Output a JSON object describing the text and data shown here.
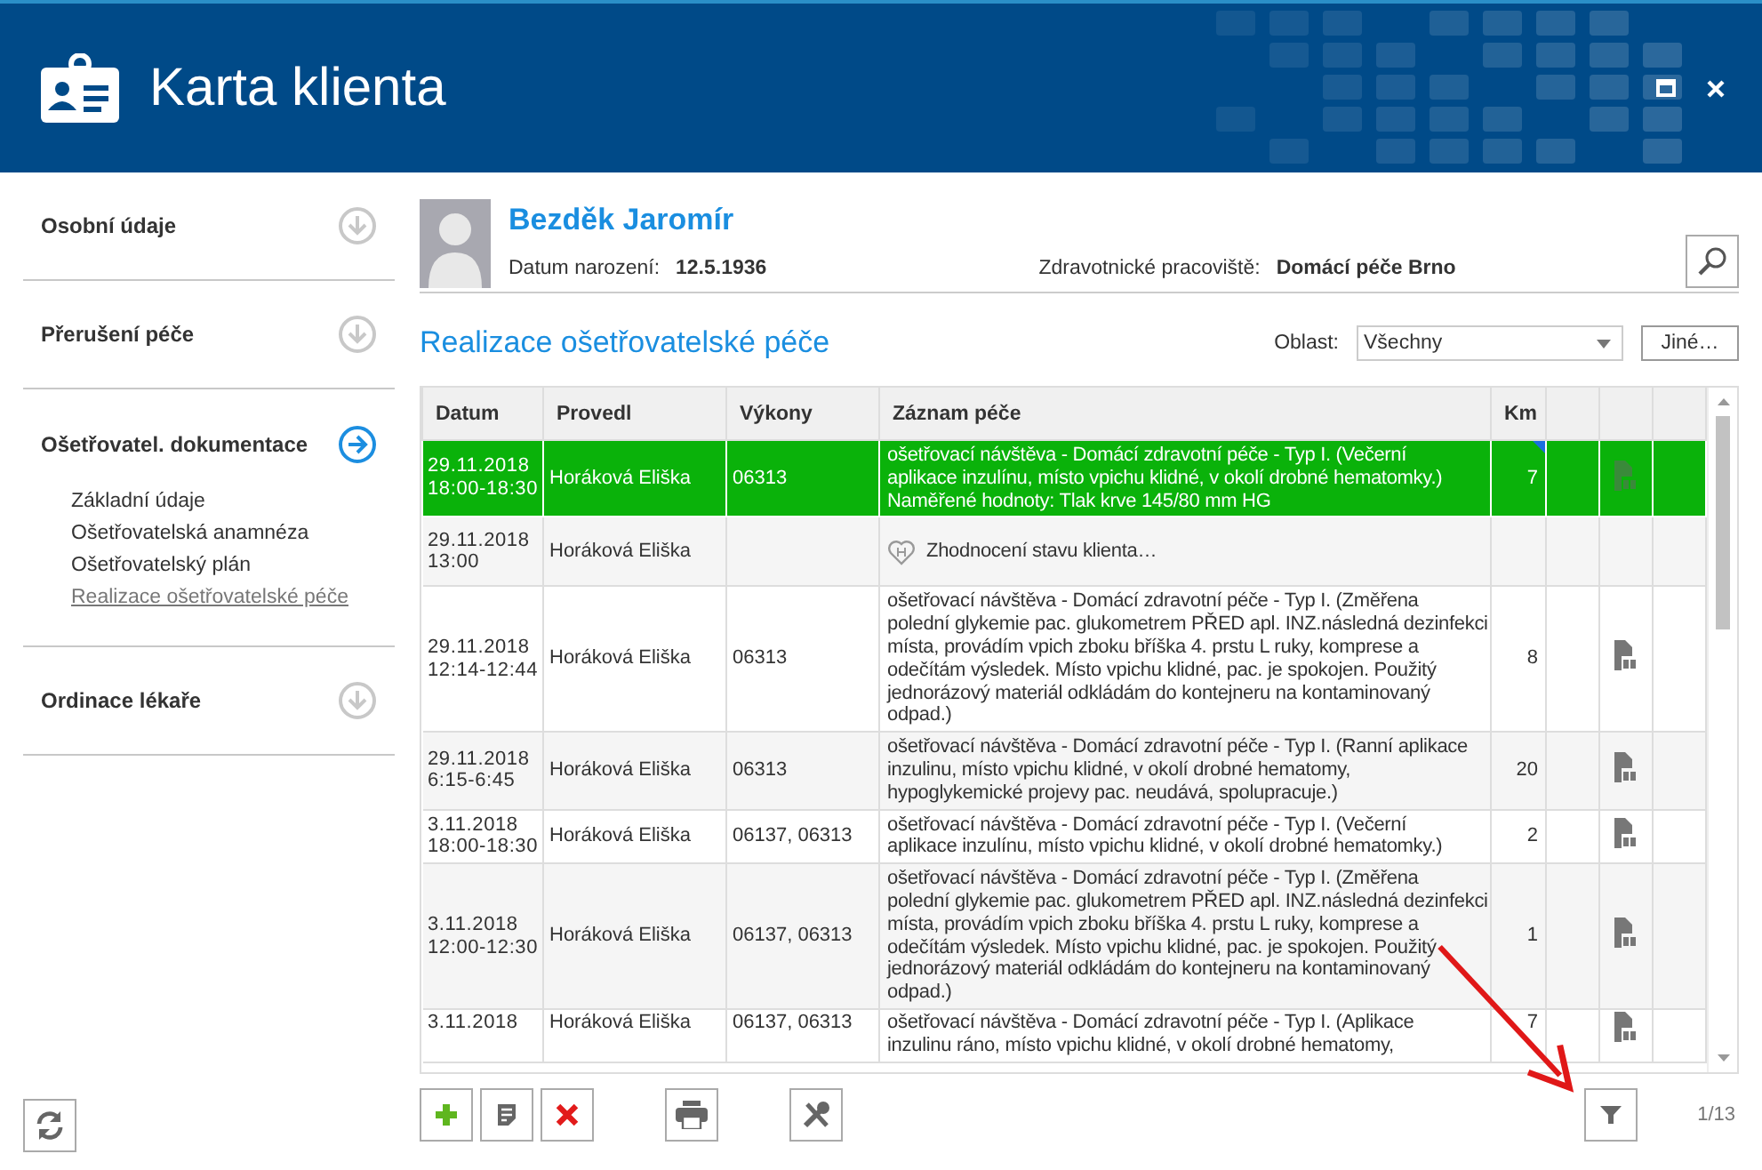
{
  "window": {
    "title": "Karta klienta"
  },
  "sidebar": {
    "sections": [
      {
        "label": "Osobní údaje",
        "selected": false
      },
      {
        "label": "Přerušení péče",
        "selected": false
      },
      {
        "label": "Ošetřovatel. dokumentace",
        "selected": true,
        "items": [
          {
            "label": "Základní údaje",
            "selected": false
          },
          {
            "label": "Ošetřovatelská anamnéza",
            "selected": false
          },
          {
            "label": "Ošetřovatelský plán",
            "selected": false
          },
          {
            "label": "Realizace ošetřovatelské péče",
            "selected": true
          }
        ]
      },
      {
        "label": "Ordinace lékaře",
        "selected": false
      }
    ]
  },
  "patient": {
    "name": "Bezděk Jaromír",
    "birth_label": "Datum narození:",
    "birth_date": "12.5.1936",
    "workplace_label": "Zdravotnické pracoviště:",
    "workplace": "Domácí péče Brno"
  },
  "section_title": "Realizace ošetřovatelské péče",
  "filter": {
    "label": "Oblast:",
    "value": "Všechny",
    "button": "Jiné…"
  },
  "table": {
    "columns": [
      "Datum",
      "Provedl",
      "Výkony",
      "Záznam péče",
      "Km"
    ],
    "rows": [
      {
        "kind": "visit",
        "selected": true,
        "datum": [
          "29.11.2018",
          "18:00-18:30"
        ],
        "provedl": "Horáková Eliška",
        "vykony": "06313",
        "zaznam": [
          "ošetřovací návštěva - Domácí zdravotní péče - Typ I. (Večerní",
          "aplikace inzulínu, místo vpichu klidné, v okolí drobné hematomky.)",
          "Naměřené hodnoty: Tlak krve 145/80 mm HG"
        ],
        "km": "7",
        "flagged": true
      },
      {
        "kind": "evaluation",
        "selected": false,
        "datum": [
          "29.11.2018",
          "13:00"
        ],
        "provedl": "Horáková Eliška",
        "vykony": "",
        "zaznam": [
          "Zhodnocení stavu klienta…"
        ],
        "km": ""
      },
      {
        "kind": "visit",
        "selected": false,
        "datum": [
          "29.11.2018",
          "12:14-12:44"
        ],
        "provedl": "Horáková Eliška",
        "vykony": "06313",
        "zaznam": [
          "ošetřovací návštěva - Domácí zdravotní péče - Typ I. (Změřena",
          "polední glykemie pac. glukometrem PŘED apl. INZ.následná dezinfekci",
          "místa, provádím vpich zboku bříška 4. prstu L ruky, komprese a",
          "odečítám výsledek. Místo vpichu klidné, pac. je spokojen. Použitý",
          "jednorázový materiál odkládám do kontejneru na kontaminovaný",
          "odpad.)"
        ],
        "km": "8"
      },
      {
        "kind": "visit",
        "selected": false,
        "datum": [
          "29.11.2018",
          "6:15-6:45"
        ],
        "provedl": "Horáková Eliška",
        "vykony": "06313",
        "zaznam": [
          "ošetřovací návštěva - Domácí zdravotní péče - Typ I. (Ranní aplikace",
          "inzulinu,  místo vpichu klidné, v okolí drobné hematomy,",
          "hypoglykemické projevy pac. neudává, spolupracuje.)"
        ],
        "km": "20"
      },
      {
        "kind": "visit",
        "selected": false,
        "datum": [
          "3.11.2018",
          "18:00-18:30"
        ],
        "provedl": "Horáková Eliška",
        "vykony": "06137, 06313",
        "zaznam": [
          "ošetřovací návštěva - Domácí zdravotní péče - Typ I. (Večerní",
          "aplikace inzulínu, místo vpichu klidné, v okolí drobné hematomky.)"
        ],
        "km": "2"
      },
      {
        "kind": "visit",
        "selected": false,
        "datum": [
          "3.11.2018",
          "12:00-12:30"
        ],
        "provedl": "Horáková Eliška",
        "vykony": "06137, 06313",
        "zaznam": [
          "ošetřovací návštěva - Domácí zdravotní péče - Typ I. (Změřena",
          "polední glykemie pac. glukometrem PŘED apl. INZ.následná dezinfekci",
          "místa, provádím vpich zboku bříška 4. prstu L ruky, komprese a",
          "odečítám výsledek. Místo vpichu klidné, pac. je spokojen. Použitý",
          "jednorázový materiál odkládám do kontejneru na kontaminovaný",
          "odpad.)"
        ],
        "km": "1"
      },
      {
        "kind": "visit",
        "selected": false,
        "datum": [
          "3.11.2018"
        ],
        "provedl": "Horáková Eliška",
        "vykony": "06137, 06313",
        "zaznam": [
          "ošetřovací návštěva - Domácí zdravotní péče - Typ I. (Aplikace",
          "inzulinu ráno,  místo vpichu klidné, v okolí drobné hematomy,"
        ],
        "km": "7"
      }
    ]
  },
  "pager": "1/13"
}
